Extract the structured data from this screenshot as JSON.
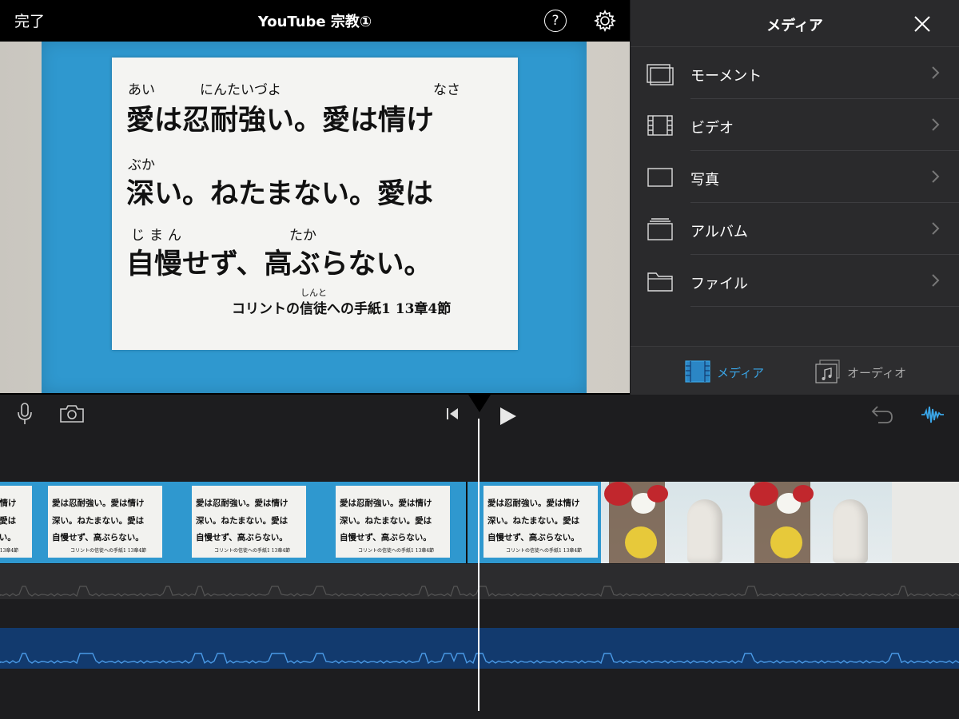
{
  "topbar": {
    "done_label": "完了",
    "project_title": "YouTube 宗教①",
    "help_label": "?"
  },
  "preview": {
    "card": {
      "line1_furigana": [
        "あい",
        "にんたいづよ",
        "なさ"
      ],
      "line1": "愛は忍耐強い。愛は情け",
      "line2_furigana": [
        "ぶか"
      ],
      "line2": "深い。ねたまない。愛は",
      "line3_furigana": [
        "じまん",
        "たか"
      ],
      "line3": "自慢せず、高ぶらない。",
      "citation_furigana": "しんと",
      "citation": "コリントの信徒への手紙1 13章4節"
    }
  },
  "media_panel": {
    "title": "メディア",
    "items": [
      {
        "label": "モーメント",
        "icon": "moments-icon"
      },
      {
        "label": "ビデオ",
        "icon": "video-film-icon"
      },
      {
        "label": "写真",
        "icon": "photo-icon"
      },
      {
        "label": "アルバム",
        "icon": "album-icon"
      },
      {
        "label": "ファイル",
        "icon": "folder-icon"
      }
    ],
    "tabs": [
      {
        "label": "メディア",
        "icon": "media-film-icon",
        "selected": true
      },
      {
        "label": "オーディオ",
        "icon": "audio-note-icon",
        "selected": false
      }
    ]
  },
  "timeline": {
    "toolbar_icons": [
      "microphone-icon",
      "camera-icon",
      "skip-to-start-icon",
      "play-icon",
      "undo-icon",
      "audio-waveform-icon"
    ],
    "thumb_text": {
      "line1": "愛は忍耐強い。愛は情け",
      "line2": "深い。ねたまない。愛は",
      "line3": "自慢せず、高ぶらない。",
      "cite": "コリントの信徒への手紙1 13章4節"
    }
  },
  "colors": {
    "accent": "#3aa6e8",
    "panel_bg": "#2a2a2c",
    "timeline_bg": "#1d1d1f",
    "audio_blue": "#123a6e",
    "card_blue": "#2f98cf"
  }
}
